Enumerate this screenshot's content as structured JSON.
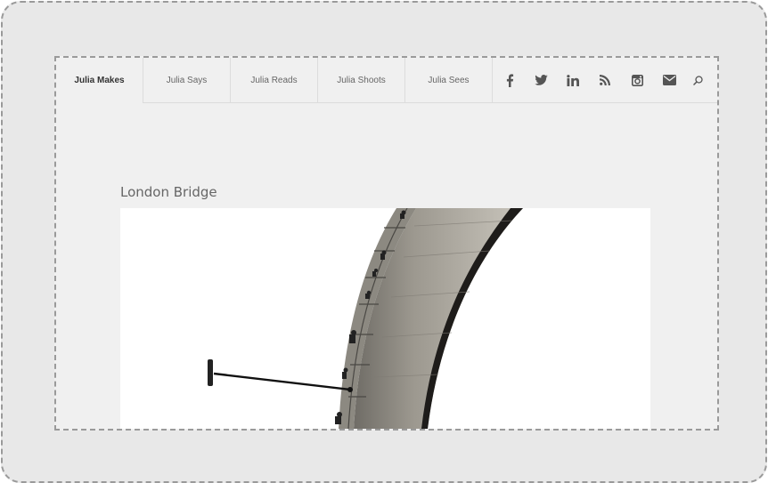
{
  "nav": {
    "tabs": [
      {
        "label": "Julia Makes",
        "active": true
      },
      {
        "label": "Julia Says",
        "active": false
      },
      {
        "label": "Julia Reads",
        "active": false
      },
      {
        "label": "Julia Shoots",
        "active": false
      },
      {
        "label": "Julia Sees",
        "active": false
      }
    ],
    "social_icons": [
      "facebook-icon",
      "twitter-icon",
      "linkedin-icon",
      "rss-icon",
      "instagram-icon",
      "envelope-icon",
      "search-icon"
    ]
  },
  "post": {
    "title": "London Bridge"
  },
  "colors": {
    "page_background": "#f0f0f0",
    "frame_background": "#e8e8e8",
    "icon_color": "#555555",
    "text_color": "#666666"
  }
}
